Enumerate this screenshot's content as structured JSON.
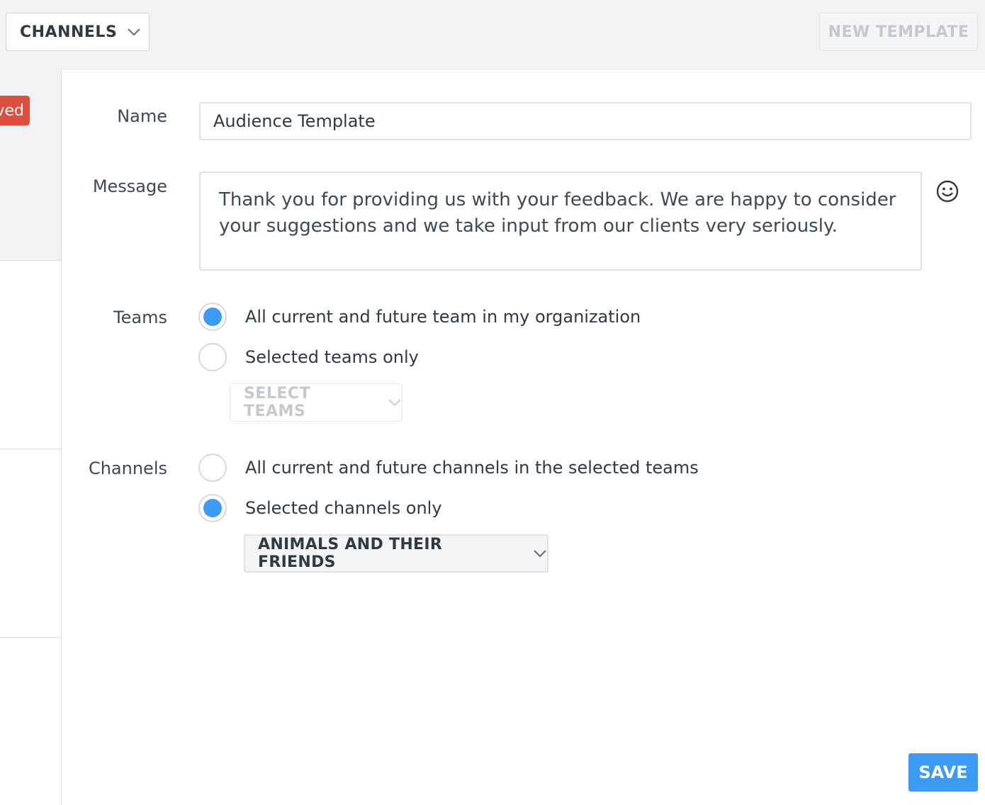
{
  "header": {
    "channels_dropdown": "CHANNELS",
    "new_template": "NEW TEMPLATE"
  },
  "sidebar": {
    "badge": "ved"
  },
  "form": {
    "name_label": "Name",
    "name_value": "Audience Template",
    "message_label": "Message",
    "message_value": "Thank you for providing us with your feedback. We are happy to consider your suggestions and we take input from our clients very seriously.",
    "teams_label": "Teams",
    "teams_options": [
      {
        "label": "All current and future team in my organization",
        "checked": true
      },
      {
        "label": "Selected teams only",
        "checked": false
      }
    ],
    "select_teams": "SELECT TEAMS",
    "channels_label": "Channels",
    "channels_options": [
      {
        "label": "All current and future channels in the selected teams",
        "checked": false
      },
      {
        "label": "Selected channels only",
        "checked": true
      }
    ],
    "selected_channel": "ANIMALS AND THEIR FRIENDS",
    "save": "SAVE"
  },
  "icons": {
    "emoji": "smiley-face-icon",
    "dropdown": "chevron-down-icon"
  },
  "colors": {
    "accent": "#3d9bf5",
    "badge": "#de4f3f"
  }
}
